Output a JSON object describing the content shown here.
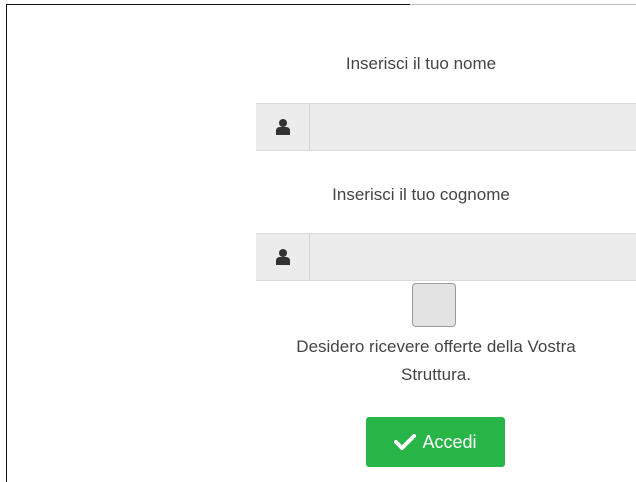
{
  "form": {
    "name_label": "Inserisci il tuo nome",
    "name_value": "",
    "surname_label": "Inserisci il tuo cognome",
    "surname_value": "",
    "consent_text_line1": "Desidero ricevere offerte della Vostra",
    "consent_text_line2": "Struttura.",
    "consent_checked": false,
    "submit_label": "Accedi",
    "user_icon": "user-icon",
    "submit_icon": "checkmark-icon"
  },
  "colors": {
    "accent_green": "#27b548",
    "field_bg": "#ececec",
    "text": "#444444"
  }
}
